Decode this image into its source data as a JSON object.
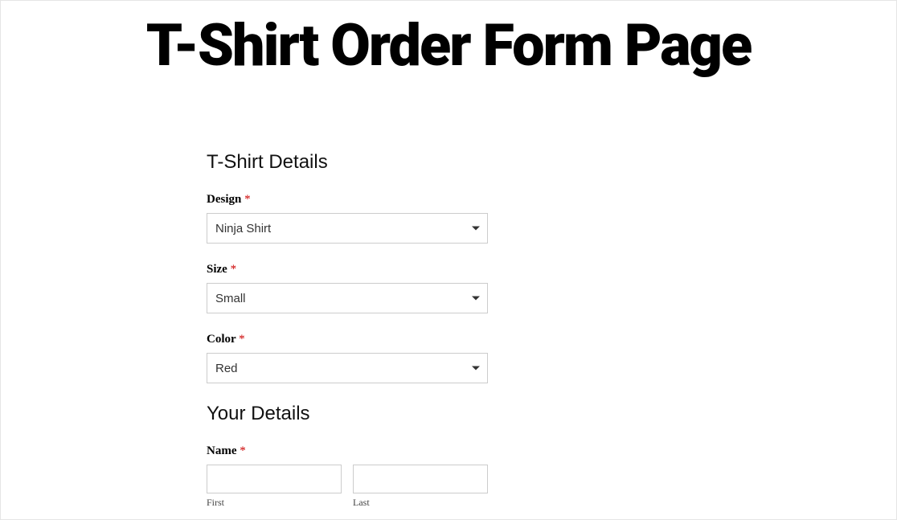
{
  "page": {
    "title": "T-Shirt Order Form Page"
  },
  "required_marker": "*",
  "sections": {
    "tshirt": {
      "heading": "T-Shirt Details",
      "design": {
        "label": "Design",
        "value": "Ninja Shirt"
      },
      "size": {
        "label": "Size",
        "value": "Small"
      },
      "color": {
        "label": "Color",
        "value": "Red"
      }
    },
    "your_details": {
      "heading": "Your Details",
      "name": {
        "label": "Name",
        "first_sublabel": "First",
        "last_sublabel": "Last"
      }
    }
  }
}
